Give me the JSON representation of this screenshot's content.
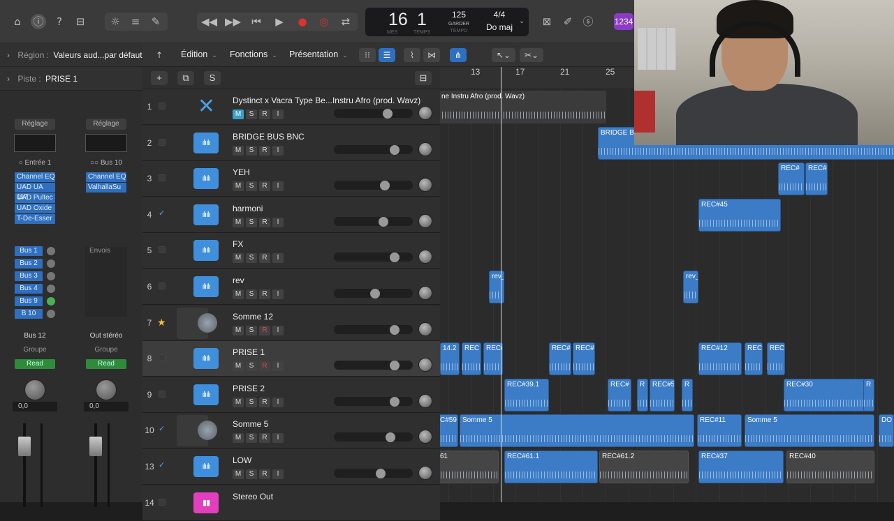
{
  "toolbar": {
    "lcd": {
      "bar": "16",
      "beat": "1",
      "bar_label": "MES",
      "beat_label": "TEMPS",
      "tempo": "125",
      "tempo_mode": "GARDER",
      "tempo_label": "TEMPO",
      "signature": "4/4",
      "key": "Do maj"
    },
    "count_in": "1234"
  },
  "inspector": {
    "region_label": "Région :",
    "region_value": "Valeurs aud...par défaut",
    "track_label": "Piste :",
    "track_value": "PRISE 1",
    "strip1": {
      "setting": "Réglage",
      "input": "Entrée 1",
      "plugins": [
        "Channel EQ",
        "UAD UA 117",
        "UAD Pultec",
        "UAD Oxide",
        "T-De-Esser"
      ],
      "sends": [
        "Bus 1",
        "Bus 2",
        "Bus 3",
        "Bus 4",
        "Bus 9",
        "B 10"
      ],
      "output": "Bus 12",
      "group": "Groupe",
      "automation": "Read",
      "vol": "0,0"
    },
    "strip2": {
      "setting": "Réglage",
      "input": "Bus 10",
      "plugins": [
        "Channel EQ",
        "ValhallaSu"
      ],
      "sends_label": "Envois",
      "output": "Out stéréo",
      "group": "Groupe",
      "automation": "Read",
      "vol": "0,0"
    }
  },
  "menu": {
    "edit": "Édition",
    "functions": "Fonctions",
    "view": "Présentation"
  },
  "tracks": [
    {
      "num": "1",
      "name": "Dystinct x Vacra Type Be...Instru Afro (prod. Wavz)",
      "checked": false
    },
    {
      "num": "2",
      "name": "BRIDGE BUS BNC",
      "checked": false
    },
    {
      "num": "3",
      "name": "YEH",
      "checked": false
    },
    {
      "num": "4",
      "name": "harmoni",
      "checked": true
    },
    {
      "num": "5",
      "name": "FX",
      "checked": false
    },
    {
      "num": "6",
      "name": "rev",
      "checked": false
    },
    {
      "num": "7",
      "name": "Somme 12",
      "checked": false
    },
    {
      "num": "8",
      "name": "PRISE 1",
      "checked": false
    },
    {
      "num": "9",
      "name": "PRISE 2",
      "checked": false
    },
    {
      "num": "10",
      "name": "Somme 5",
      "checked": true
    },
    {
      "num": "13",
      "name": "LOW",
      "checked": true
    },
    {
      "num": "14",
      "name": "Stereo Out",
      "checked": false
    }
  ],
  "msri": {
    "m": "M",
    "s": "S",
    "r": "R",
    "i": "I"
  },
  "ruler": [
    "13",
    "17",
    "21",
    "25"
  ],
  "regions": {
    "r1": "ne Instru Afro (prod. Wavz)",
    "r2": "BRIDGE BUS",
    "r3a": "REC#",
    "r3b": "REC#",
    "r4": "REC#45",
    "r6a": "rev_",
    "r6b": "rev_",
    "r8a": "14.2",
    "r8b": "REC",
    "r8c": "REC#",
    "r8d": "REC#",
    "r8e": "REC#",
    "r8f": "REC#12",
    "r8g": "REC",
    "r8h": "REC",
    "r9a": "REC#39.1",
    "r9b": "REC#",
    "r9c": "R",
    "r9d": "REC#5",
    "r9e": "R",
    "r9f": "REC#30",
    "r9g": "R",
    "r10a": "C#59",
    "r10b": "Somme 5",
    "r10c": "REC#11",
    "r10d": "Somme 5",
    "r10e": "DO",
    "r13a": "61",
    "r13b": "REC#61.1",
    "r13c": "REC#61.2",
    "r13d": "REC#37",
    "r13e": "REC#40"
  }
}
